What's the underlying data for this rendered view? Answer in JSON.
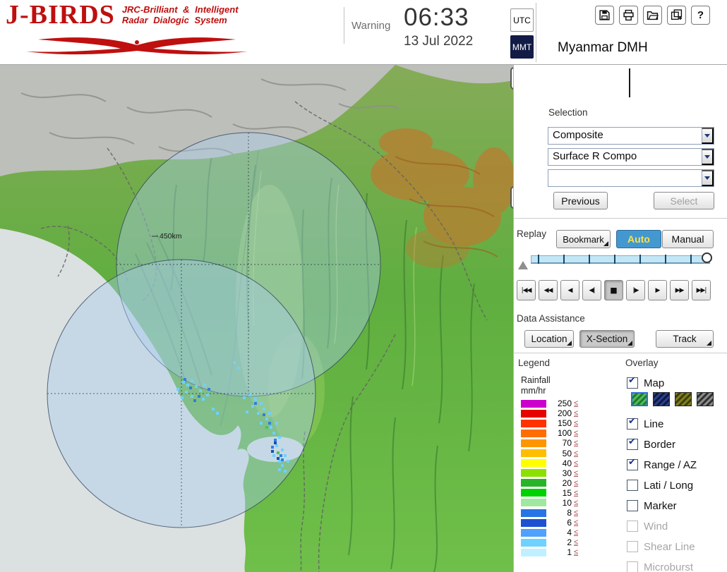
{
  "header": {
    "logo_title": "J-BIRDS",
    "logo_sub1": "JRC-Brilliant & Intelligent",
    "logo_sub2": "Radar Dialogic System",
    "warning": "Warning",
    "time": "06:33",
    "date": "13 Jul 2022",
    "tz_utc": "UTC",
    "tz_mmt": "MMT",
    "station_title": "Myanmar DMH",
    "toolbar_icons": [
      "save-icon",
      "print-icon",
      "open-folder-icon",
      "add-map-icon",
      "help-icon"
    ],
    "help_glyph": "?"
  },
  "selection": {
    "label": "Selection",
    "dropdowns": [
      "Composite",
      "Surface R Compo",
      ""
    ],
    "previous": "Previous",
    "select": "Select"
  },
  "replay": {
    "label": "Replay",
    "bookmark": "Bookmark",
    "auto": "Auto",
    "manual": "Manual",
    "buttons": [
      "|◀◀",
      "◀◀",
      "◀",
      "◀|",
      "■",
      "|▶",
      "▶",
      "▶▶",
      "▶▶|"
    ],
    "button_names": [
      "go-to-start",
      "fast-rewind",
      "reverse-play",
      "step-back",
      "stop",
      "step-forward",
      "play",
      "fast-forward",
      "go-to-end"
    ],
    "active_index": 4
  },
  "data_assistance": {
    "label": "Data Assistance",
    "buttons": [
      "Location",
      "X-Section",
      "Track"
    ],
    "pressed_index": 1
  },
  "legend": {
    "label": "Legend",
    "unit_line1": "Rainfall",
    "unit_line2": "mm/hr",
    "le": "≤",
    "rows": [
      {
        "value": "250",
        "color": "#cc00cc"
      },
      {
        "value": "200",
        "color": "#e60000"
      },
      {
        "value": "150",
        "color": "#ff3200"
      },
      {
        "value": "100",
        "color": "#ff6e00"
      },
      {
        "value": "70",
        "color": "#ff9600"
      },
      {
        "value": "50",
        "color": "#ffbe00"
      },
      {
        "value": "40",
        "color": "#ffff00"
      },
      {
        "value": "30",
        "color": "#8ce000"
      },
      {
        "value": "20",
        "color": "#28b428"
      },
      {
        "value": "15",
        "color": "#00d200"
      },
      {
        "value": "10",
        "color": "#a0e8a0"
      },
      {
        "value": "8",
        "color": "#2874e6"
      },
      {
        "value": "6",
        "color": "#1e50d2"
      },
      {
        "value": "4",
        "color": "#50a0ff"
      },
      {
        "value": "2",
        "color": "#6ed2ff"
      },
      {
        "value": "1",
        "color": "#c0f0ff"
      }
    ]
  },
  "overlay": {
    "label": "Overlay",
    "check_glyph": "✔",
    "items": [
      {
        "label": "Map",
        "checked": true,
        "enabled": true
      },
      {
        "label": "Line",
        "checked": true,
        "enabled": true
      },
      {
        "label": "Border",
        "checked": true,
        "enabled": true
      },
      {
        "label": "Range / AZ",
        "checked": true,
        "enabled": true
      },
      {
        "label": "Lati / Long",
        "checked": false,
        "enabled": true
      },
      {
        "label": "Marker",
        "checked": false,
        "enabled": true
      },
      {
        "label": "Wind",
        "checked": false,
        "enabled": false
      },
      {
        "label": "Shear Line",
        "checked": false,
        "enabled": false
      },
      {
        "label": "Microburst",
        "checked": false,
        "enabled": false
      }
    ],
    "map_styles": [
      {
        "name": "green",
        "selected": true
      },
      {
        "name": "navy",
        "selected": false
      },
      {
        "name": "olive",
        "selected": false
      },
      {
        "name": "dark-gray",
        "selected": false
      }
    ]
  },
  "map": {
    "range_label": "450km"
  },
  "colors": {
    "logo_red": "#bf0f0f",
    "tz_active_bg": "#131c46",
    "tz_active_text": "#ffffff",
    "auto_bg": "#4398cf",
    "auto_text": "#ffe14a",
    "timeline_track": "#c2e6f5",
    "sea": "#dbe0e1",
    "radar_fill": "#a9ccee"
  }
}
